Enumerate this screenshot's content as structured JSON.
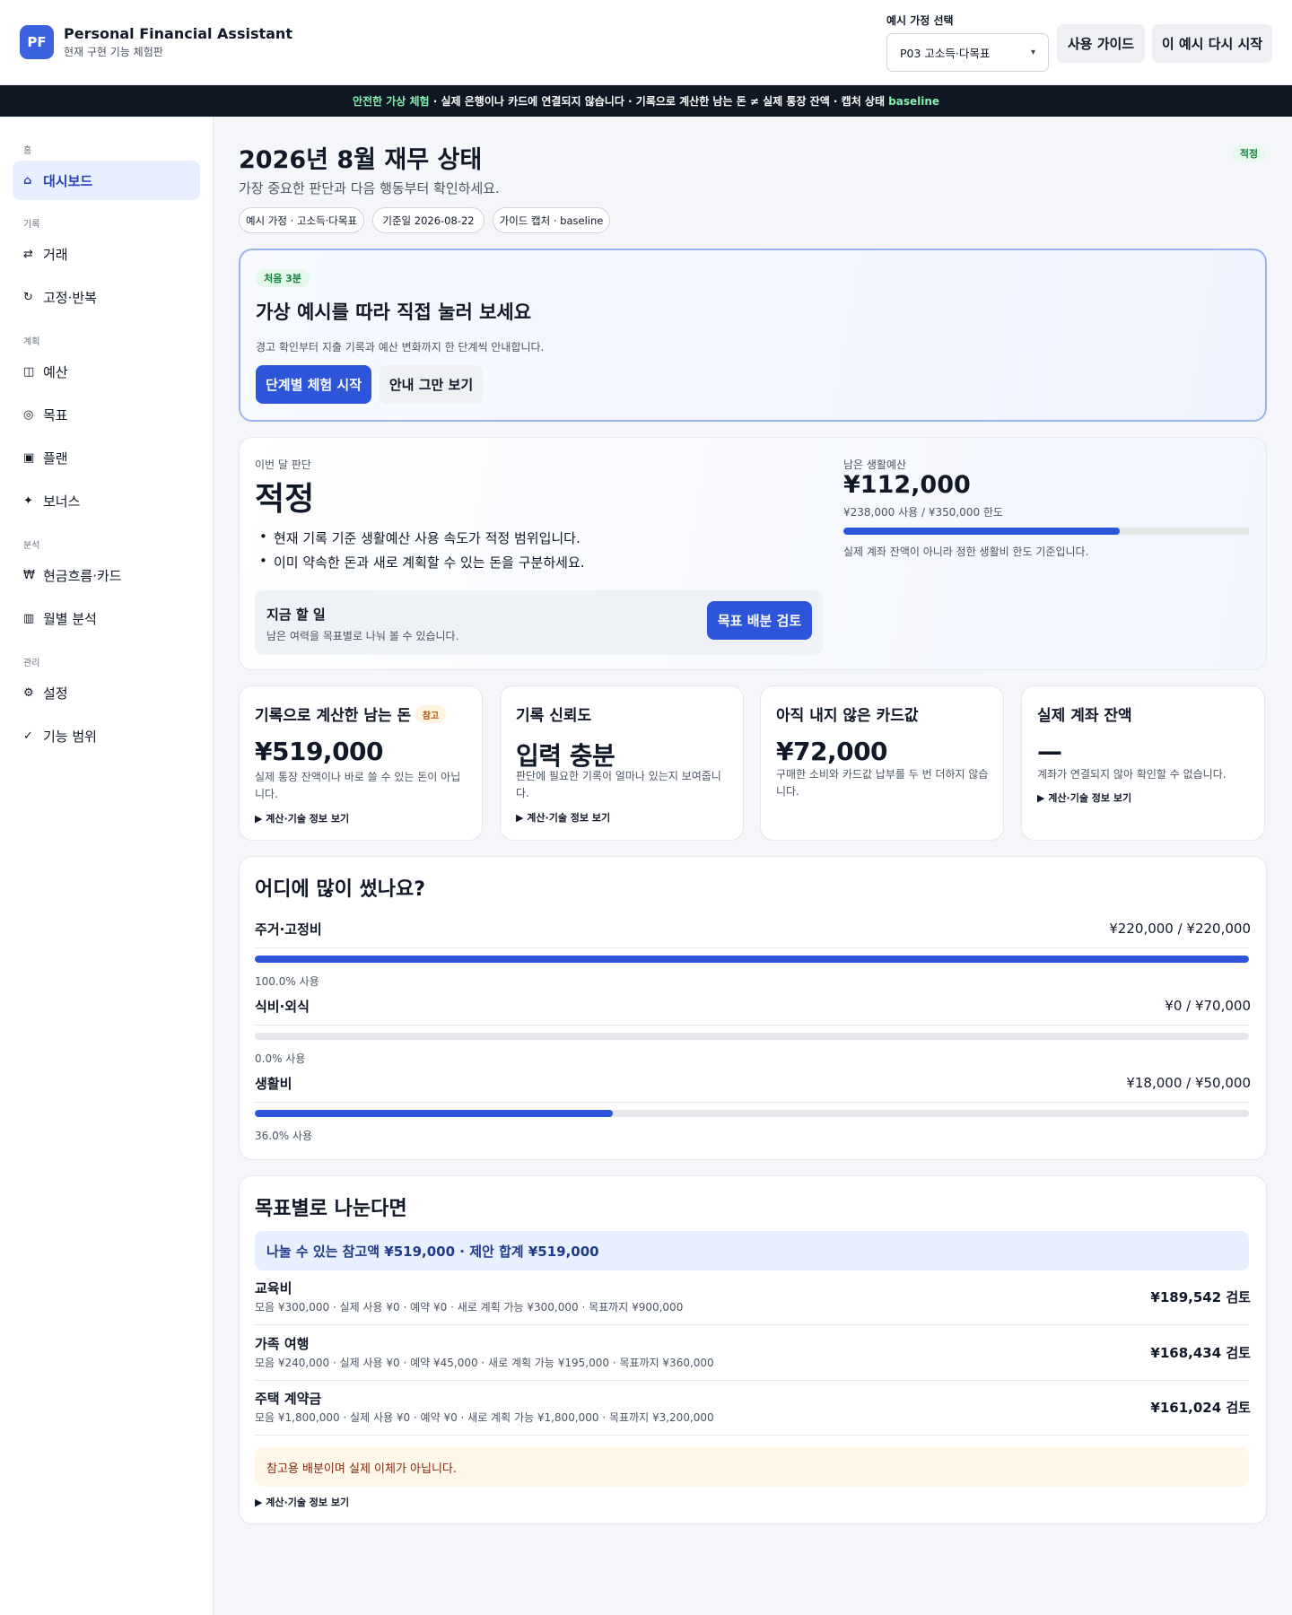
{
  "header": {
    "logo_text": "PF",
    "app_title": "Personal Financial Assistant",
    "app_subtitle": "현재 구현 기능 체험판",
    "select_label": "예시 가정 선택",
    "select_value": "P03 고소득·다목표",
    "guide_button": "사용 가이드",
    "restart_button": "이 예시 다시 시작"
  },
  "banner": {
    "highlight": "안전한 가상 체험",
    "text": " · 실제 은행이나 카드에 연결되지 않습니다 · 기록으로 계산한 남는 돈 ≠ 실제 통장 잔액 · 캡처 상태 ",
    "state": "baseline"
  },
  "sidebar": {
    "groups": [
      "홈",
      "기록",
      "계획",
      "분석",
      "관리"
    ],
    "items": [
      {
        "label": "대시보드",
        "icon": "home-icon",
        "glyph": "⌂"
      },
      {
        "label": "거래",
        "icon": "transfer-icon",
        "glyph": "⇄"
      },
      {
        "label": "고정·반복",
        "icon": "repeat-icon",
        "glyph": "↻"
      },
      {
        "label": "예산",
        "icon": "budget-icon",
        "glyph": "◫"
      },
      {
        "label": "목표",
        "icon": "target-icon",
        "glyph": "◎"
      },
      {
        "label": "플랜",
        "icon": "plan-icon",
        "glyph": "▣"
      },
      {
        "label": "보너스",
        "icon": "sparkle-icon",
        "glyph": "✦"
      },
      {
        "label": "현금흐름·카드",
        "icon": "won-icon",
        "glyph": "₩"
      },
      {
        "label": "월별 분석",
        "icon": "bar-chart-icon",
        "glyph": "▥"
      },
      {
        "label": "설정",
        "icon": "gear-icon",
        "glyph": "⚙"
      },
      {
        "label": "기능 범위",
        "icon": "check-icon",
        "glyph": "✓"
      }
    ]
  },
  "main": {
    "title": "2026년 8월 재무 상태",
    "subtitle": "가장 중요한 판단과 다음 행동부터 확인하세요.",
    "status_badge": "적정",
    "chips": [
      "예시 가정 · 고소득·다목표",
      "기준일 2026-08-22",
      "가이드 캡처 · baseline"
    ]
  },
  "onboarding": {
    "pill": "처음 3분",
    "title": "가상 예시를 따라 직접 눌러 보세요",
    "description": "경고 확인부터 지출 기록과 예산 변화까지 한 단계씩 안내합니다.",
    "start_button": "단계별 체험 시작",
    "dismiss_button": "안내 그만 보기"
  },
  "judgment": {
    "label": "이번 달 판단",
    "value": "적정",
    "bullets": [
      "현재 기록 기준 생활예산 사용 속도가 적정 범위입니다.",
      "이미 약속한 돈과 새로 계획할 수 있는 돈을 구분하세요."
    ],
    "todo_title": "지금 할 일",
    "todo_desc": "남은 여력을 목표별로 나눠 볼 수 있습니다.",
    "todo_button": "목표 배분 검토",
    "remaining_label": "남은 생활예산",
    "remaining_value": "¥112,000",
    "remaining_detail": "¥238,000 사용 / ¥350,000 한도",
    "remaining_ratio": 0.68,
    "remaining_note": "실제 계좌 잔액이 아니라 정한 생활비 한도 기준입니다."
  },
  "metrics": [
    {
      "title": "기록으로 계산한 남는 돈",
      "badge": "참고",
      "value": "¥519,000",
      "desc": "실제 통장 잔액이나 바로 쓸 수 있는 돈이 아닙니다.",
      "link": "▶ 계산·기술 정보 보기"
    },
    {
      "title": "기록 신뢰도",
      "value": "입력 충분",
      "desc": "판단에 필요한 기록이 얼마나 있는지 보여줍니다.",
      "link": "▶ 계산·기술 정보 보기"
    },
    {
      "title": "아직 내지 않은 카드값",
      "value": "¥72,000",
      "desc": "구매한 소비와 카드값 납부를 두 번 더하지 않습니다."
    },
    {
      "title": "실제 계좌 잔액",
      "value": "—",
      "desc": "계좌가 연결되지 않아 확인할 수 없습니다.",
      "link": "▶ 계산·기술 정보 보기"
    }
  ],
  "spending": {
    "title": "어디에 많이 썼나요?",
    "rows": [
      {
        "name": "주거·고정비",
        "amount": "¥220,000 / ¥220,000",
        "ratio": 1.0,
        "pct": "100.0% 사용"
      },
      {
        "name": "식비·외식",
        "amount": "¥0 / ¥70,000",
        "ratio": 0.0,
        "pct": "0.0% 사용"
      },
      {
        "name": "생활비",
        "amount": "¥18,000 / ¥50,000",
        "ratio": 0.36,
        "pct": "36.0% 사용"
      }
    ]
  },
  "goals": {
    "title": "목표별로 나눈다면",
    "summary": "나눌 수 있는 참고액 ¥519,000 · 제안 합계 ¥519,000",
    "items": [
      {
        "name": "교육비",
        "detail": "모음 ¥300,000 · 실제 사용 ¥0 · 예약 ¥0 · 새로 계획 가능 ¥300,000 · 목표까지 ¥900,000",
        "amount": "¥189,542 검토"
      },
      {
        "name": "가족 여행",
        "detail": "모음 ¥240,000 · 실제 사용 ¥0 · 예약 ¥45,000 · 새로 계획 가능 ¥195,000 · 목표까지 ¥360,000",
        "amount": "¥168,434 검토"
      },
      {
        "name": "주택 계약금",
        "detail": "모음 ¥1,800,000 · 실제 사용 ¥0 · 예약 ¥0 · 새로 계획 가능 ¥1,800,000 · 목표까지 ¥3,200,000",
        "amount": "¥161,024 검토"
      }
    ],
    "warning": "참고용 배분이며 실제 이체가 아닙니다.",
    "link": "▶ 계산·기술 정보 보기"
  },
  "colors": {
    "accent": "#2c55d9",
    "banner_bg": "#0f1724",
    "ok_green": "#15803d"
  }
}
